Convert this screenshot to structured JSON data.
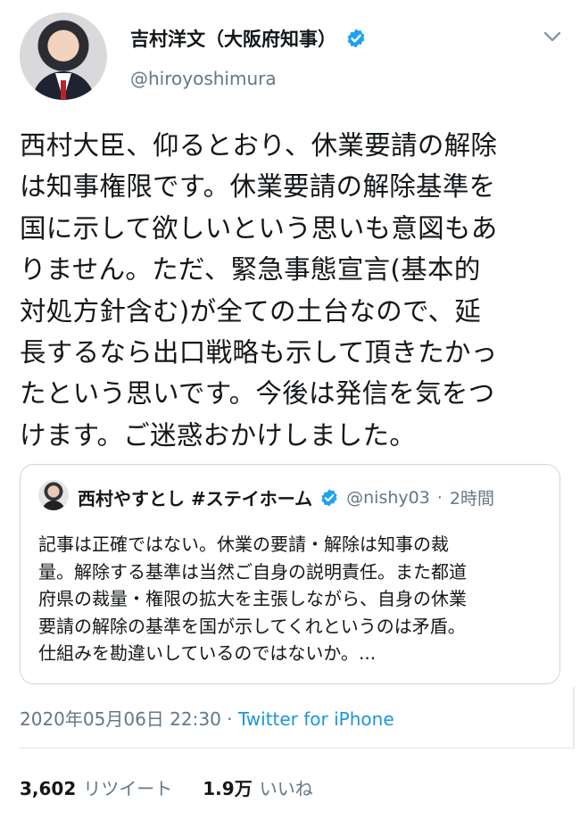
{
  "author": {
    "display_name": "吉村洋文（大阪府知事）",
    "handle": "@hiroyoshimura",
    "verified_icon": "verified-badge-icon",
    "avatar": "profile-photo"
  },
  "tweet": {
    "text": "西村大臣、仰るとおり、休業要請の解除\nは知事権限です。休業要請の解除基準を\n国に示して欲しいという思いも意図もあ\nりません。ただ、緊急事態宣言(基本的\n対処方針含む)が全ての土台なので、延\n長するなら出口戦略も示して頂きたかっ\nたという思いです。今後は発信を気をつ\nけます。ご迷惑おかけしました。"
  },
  "quoted_tweet": {
    "display_name": "西村やすとし #ステイホーム",
    "handle": "@nishy03",
    "separator": "·",
    "time": "2時間",
    "text": "記事は正確ではない。休業の要請・解除は知事の裁\n量。解除する基準は当然ご自身の説明責任。また都道\n府県の裁量・権限の拡大を主張しながら、自身の休業\n要請の解除の基準を国が示してくれというのは矛盾。\n仕組みを勘違いしているのではないか。..."
  },
  "meta": {
    "datetime": "2020年05月06日 22:30",
    "separator": " · ",
    "source": "Twitter for iPhone"
  },
  "stats": {
    "retweets_count": "3,602",
    "retweets_label": "リツイート",
    "likes_count": "1.9万",
    "likes_label": "いいね"
  },
  "colors": {
    "verified": "#1da1f2",
    "link": "#1b95e0",
    "secondary_text": "#657786",
    "border": "#ccd6dd"
  }
}
